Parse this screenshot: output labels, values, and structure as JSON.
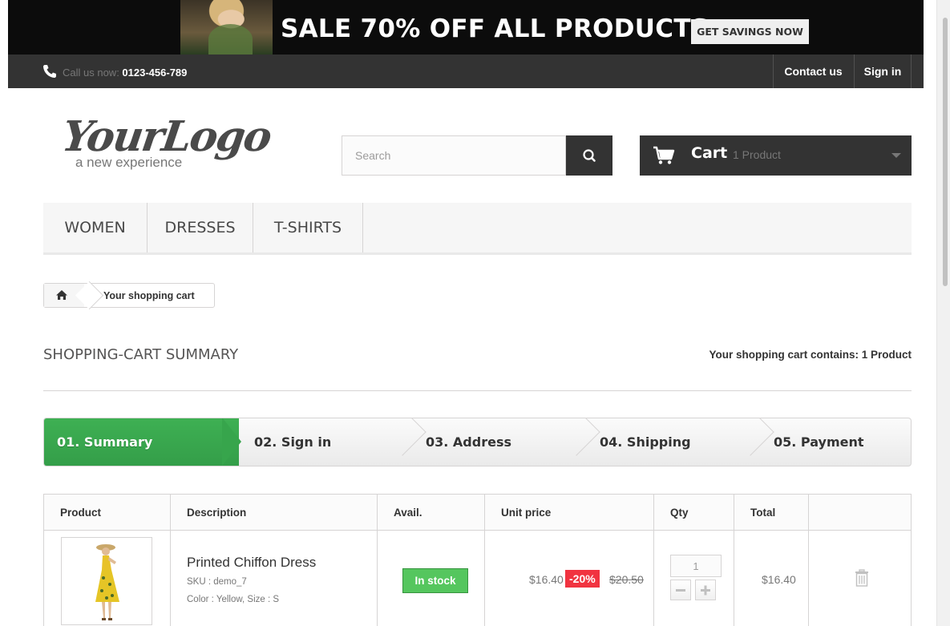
{
  "banner": {
    "text": "SALE 70% OFF ALL PRODUCTS",
    "button_label": "GET SAVINGS NOW"
  },
  "topnav": {
    "call_prefix": "Call us now: ",
    "phone": "0123-456-789",
    "contact_label": "Contact us",
    "signin_label": "Sign in"
  },
  "header": {
    "logo_main": "YourLogo",
    "logo_sub": "a new experience",
    "search_placeholder": "Search",
    "search_value": "",
    "cart_label": "Cart",
    "cart_count": "1 Product"
  },
  "menu": {
    "items": [
      "WOMEN",
      "DRESSES",
      "T-SHIRTS"
    ]
  },
  "breadcrumb": {
    "current": "Your shopping cart"
  },
  "summary": {
    "title": "SHOPPING-CART SUMMARY",
    "count_text": "Your shopping cart contains: 1 Product"
  },
  "steps": [
    "01. Summary",
    "02. Sign in",
    "03. Address",
    "04. Shipping",
    "05. Payment"
  ],
  "active_step": 0,
  "cart_table": {
    "headers": [
      "Product",
      "Description",
      "Avail.",
      "Unit price",
      "Qty",
      "Total"
    ],
    "rows": [
      {
        "name": "Printed Chiffon Dress",
        "sku": "SKU : demo_7",
        "attributes": "Color : Yellow, Size : S",
        "availability": "In stock",
        "unit_price": "$16.40",
        "reduction": "-20%",
        "old_price": "$20.50",
        "qty": "1",
        "total": "$16.40"
      }
    ]
  },
  "colors": {
    "dark": "#333333",
    "green": "#3eb053",
    "stock_green": "#55c65e",
    "reduction_red": "#f13340"
  }
}
